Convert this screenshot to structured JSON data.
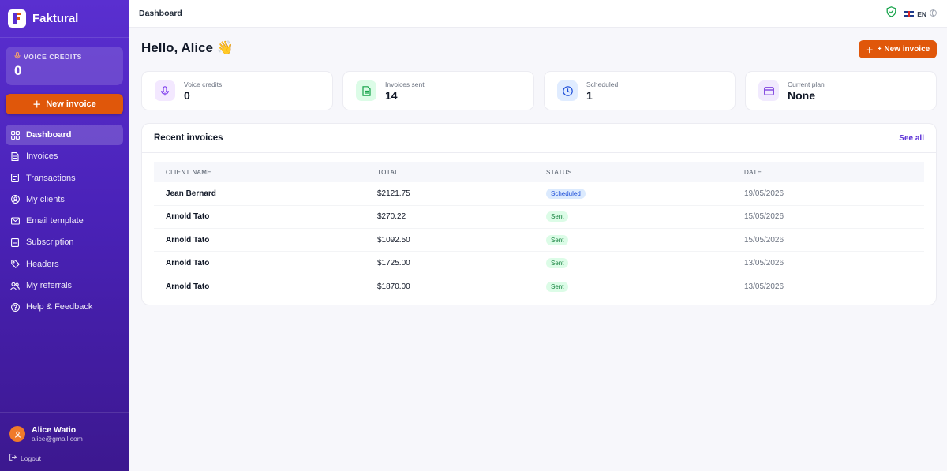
{
  "app": {
    "name": "Faktural"
  },
  "sidebar": {
    "credits_label": "VOICE CREDITS",
    "credits_value": "0",
    "new_invoice_label": "New invoice",
    "items": [
      {
        "label": "Dashboard",
        "icon": "dashboard-icon",
        "active": true
      },
      {
        "label": "Invoices",
        "icon": "invoice-icon"
      },
      {
        "label": "Transactions",
        "icon": "transactions-icon"
      },
      {
        "label": "My clients",
        "icon": "clients-icon"
      },
      {
        "label": "Email template",
        "icon": "mail-icon"
      },
      {
        "label": "Subscription",
        "icon": "card-icon"
      },
      {
        "label": "Headers",
        "icon": "tag-icon"
      },
      {
        "label": "My referrals",
        "icon": "referrals-icon"
      },
      {
        "label": "Help & Feedback",
        "icon": "help-icon"
      }
    ],
    "user": {
      "name": "Alice Watio",
      "email": "alice@gmail.com"
    },
    "logout_label": "Logout"
  },
  "topbar": {
    "title": "Dashboard",
    "lang": "EN"
  },
  "main": {
    "greeting": "Hello, Alice 👋",
    "new_invoice_label": "+ New invoice",
    "stats": [
      {
        "label": "Voice credits",
        "value": "0",
        "icon": "mic-icon",
        "accent": "#7c3aed"
      },
      {
        "label": "Invoices sent",
        "value": "14",
        "icon": "document-icon",
        "accent": "#16a34a"
      },
      {
        "label": "Scheduled",
        "value": "1",
        "icon": "clock-icon",
        "accent": "#1d4ed8"
      },
      {
        "label": "Current plan",
        "value": "None",
        "icon": "card-icon",
        "accent": "#7c3aed"
      }
    ],
    "recent": {
      "title": "Recent invoices",
      "see_all": "See all",
      "columns": [
        "CLIENT NAME",
        "TOTAL",
        "STATUS",
        "DATE"
      ],
      "rows": [
        {
          "client": "Jean Bernard",
          "total": "$2121.75",
          "status": "Scheduled",
          "date": "19/05/2026"
        },
        {
          "client": "Arnold Tato",
          "total": "$270.22",
          "status": "Sent",
          "date": "15/05/2026"
        },
        {
          "client": "Arnold Tato",
          "total": "$1092.50",
          "status": "Sent",
          "date": "15/05/2026"
        },
        {
          "client": "Arnold Tato",
          "total": "$1725.00",
          "status": "Sent",
          "date": "13/05/2026"
        },
        {
          "client": "Arnold Tato",
          "total": "$1870.00",
          "status": "Sent",
          "date": "13/05/2026"
        }
      ]
    }
  },
  "colors": {
    "brand": "#5a2fd0",
    "accent": "#e0570a"
  }
}
